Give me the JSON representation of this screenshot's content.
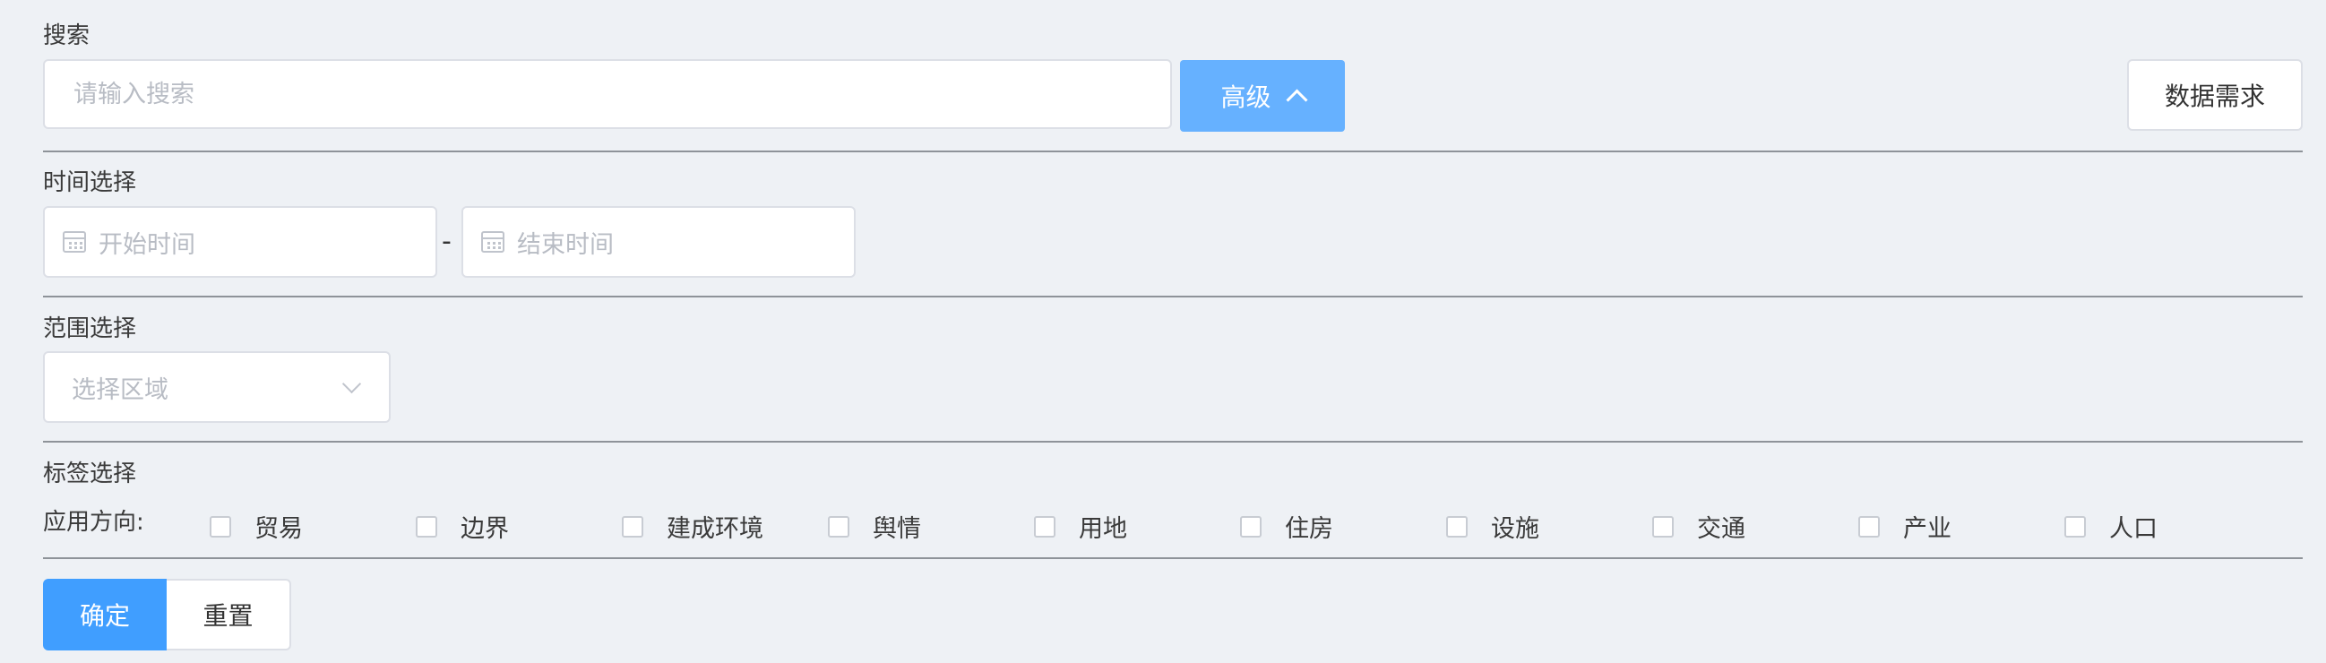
{
  "search": {
    "label": "搜索",
    "placeholder": "请输入搜索",
    "advanced_label": "高级",
    "demand_label": "数据需求"
  },
  "time": {
    "label": "时间选择",
    "start_placeholder": "开始时间",
    "separator": "-",
    "end_placeholder": "结束时间"
  },
  "range": {
    "label": "范围选择",
    "placeholder": "选择区域"
  },
  "tags": {
    "label": "标签选择",
    "application_label": "应用方向:",
    "options": [
      "贸易",
      "边界",
      "建成环境",
      "舆情",
      "用地",
      "住房",
      "设施",
      "交通",
      "产业",
      "人口"
    ]
  },
  "actions": {
    "confirm_label": "确定",
    "reset_label": "重置"
  },
  "colors": {
    "primary": "#409eff",
    "primary_light": "#66b1ff",
    "background": "#eef1f5"
  }
}
